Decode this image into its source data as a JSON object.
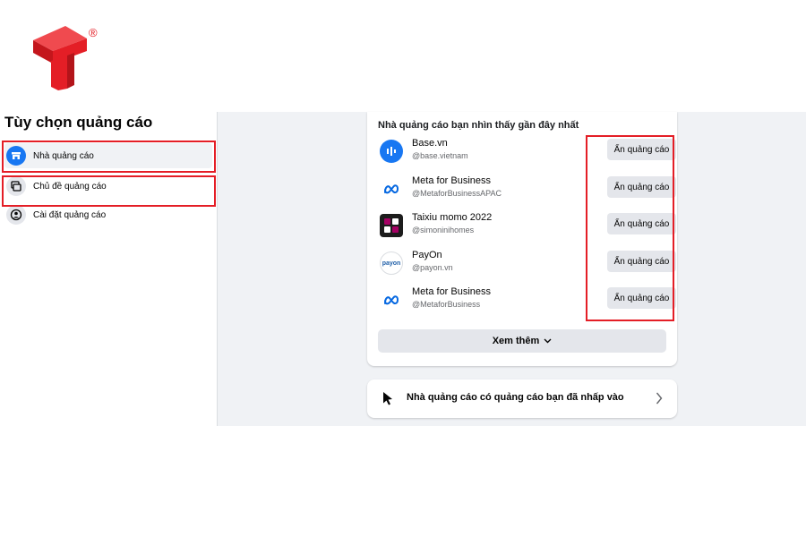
{
  "logo": {
    "registered_mark": "®",
    "brand_color": "#e41e26"
  },
  "page": {
    "title": "Tùy chọn quảng cáo"
  },
  "sidebar": {
    "items": [
      {
        "label": "Nhà quảng cáo",
        "icon": "storefront-icon",
        "active": true
      },
      {
        "label": "Chủ đề quảng cáo",
        "icon": "topics-icon",
        "active": false
      },
      {
        "label": "Cài đặt quảng cáo",
        "icon": "user-settings-icon",
        "active": false
      }
    ]
  },
  "advertisers": {
    "title": "Nhà quảng cáo bạn nhìn thấy gần đây nhất",
    "hide_label": "Ẩn quảng cáo",
    "items": [
      {
        "name": "Base.vn",
        "handle": "@base.vietnam",
        "icon": "base-logo-icon"
      },
      {
        "name": "Meta for Business",
        "handle": "@MetaforBusinessAPAC",
        "icon": "meta-logo-icon"
      },
      {
        "name": "Taixiu momo 2022",
        "handle": "@simoninihomes",
        "icon": "momo-logo-icon"
      },
      {
        "name": "PayOn",
        "handle": "@payon.vn",
        "icon": "payon-logo-icon",
        "logo_text": "payon"
      },
      {
        "name": "Meta for Business",
        "handle": "@MetaforBusiness",
        "icon": "meta-logo-icon"
      }
    ],
    "see_more_label": "Xem thêm"
  },
  "clicked_advertisers": {
    "label": "Nhà quảng cáo có quảng cáo bạn đã nhấp vào"
  },
  "colors": {
    "accent": "#1877f2",
    "highlight": "#e41e26",
    "panel_bg": "#f0f2f5",
    "button_bg": "#e4e6eb"
  }
}
